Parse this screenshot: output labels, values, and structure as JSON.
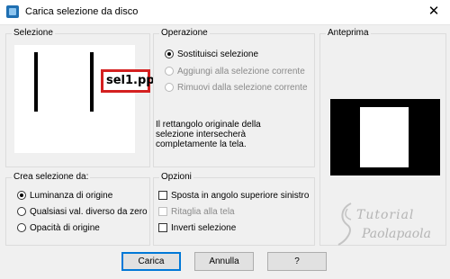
{
  "window": {
    "title": "Carica selezione da disco",
    "close_glyph": "✕"
  },
  "selezione": {
    "title": "Selezione",
    "file_label": "sel1.pp"
  },
  "operazione": {
    "title": "Operazione",
    "options": [
      {
        "label": "Sostituisci selezione",
        "checked": true,
        "enabled": true
      },
      {
        "label": "Aggiungi alla selezione corrente",
        "checked": false,
        "enabled": false
      },
      {
        "label": "Rimuovi dalla selezione corrente",
        "checked": false,
        "enabled": false
      }
    ],
    "info_line1": "Il rettangolo originale della",
    "info_line2": "selezione intersecherà",
    "info_line3": "completamente la tela."
  },
  "anteprima": {
    "title": "Anteprima"
  },
  "crea_selezione": {
    "title": "Crea selezione da:",
    "options": [
      {
        "label": "Luminanza di origine",
        "checked": true
      },
      {
        "label": "Qualsiasi val. diverso da zero",
        "checked": false
      },
      {
        "label": "Opacità di origine",
        "checked": false
      }
    ]
  },
  "opzioni": {
    "title": "Opzioni",
    "items": [
      {
        "label": "Sposta in angolo superiore sinistro",
        "checked": false,
        "enabled": true
      },
      {
        "label": "Ritaglia alla tela",
        "checked": false,
        "enabled": false
      },
      {
        "label": "Inverti selezione",
        "checked": false,
        "enabled": true
      }
    ]
  },
  "buttons": {
    "load": "Carica",
    "cancel": "Annulla",
    "help": "?"
  },
  "watermark": {
    "line1": "Tutorial",
    "line2": "Paolapaola"
  },
  "colors": {
    "accent": "#0078d7",
    "highlight_border": "#d42020"
  }
}
